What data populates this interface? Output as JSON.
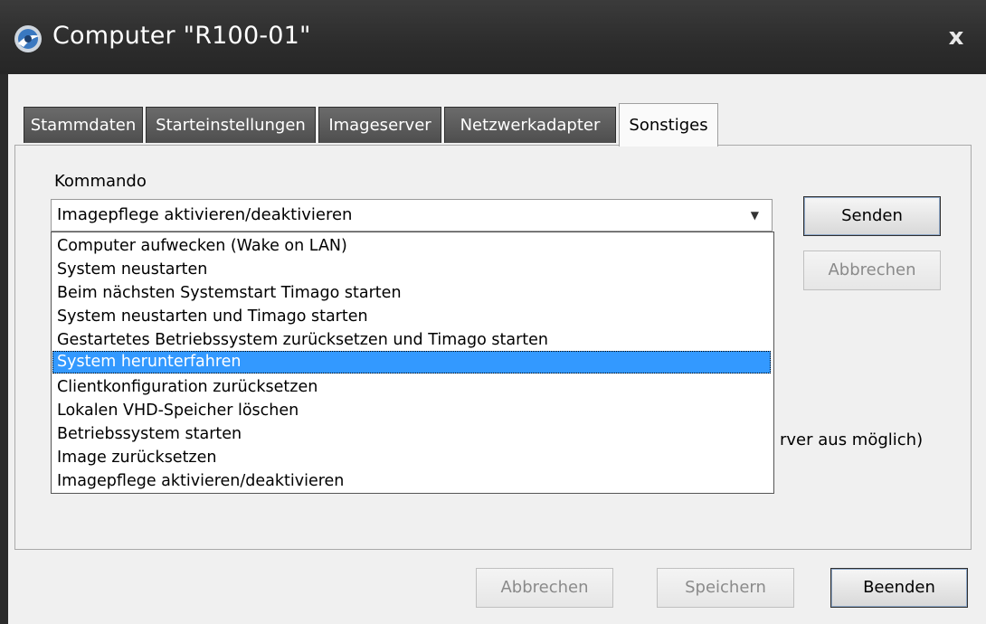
{
  "window": {
    "title": "Computer \"R100-01\"",
    "close_glyph": "x",
    "icon": "app-logo-icon"
  },
  "tabs": [
    {
      "label": "Stammdaten",
      "active": false
    },
    {
      "label": "Starteinstellungen",
      "active": false
    },
    {
      "label": "Imageserver",
      "active": false
    },
    {
      "label": "Netzwerkadapter",
      "active": false
    },
    {
      "label": "Sonstiges",
      "active": true
    }
  ],
  "kommando": {
    "label": "Kommando",
    "selected_value": "Imagepflege aktivieren/deaktivieren",
    "options": [
      "Computer aufwecken (Wake on LAN)",
      "System neustarten",
      "Beim nächsten Systemstart Timago starten",
      "System neustarten und Timago starten",
      "Gestartetes Betriebssystem zurücksetzen und Timago starten",
      "System herunterfahren",
      "Clientkonfiguration zurücksetzen",
      "Lokalen VHD-Speicher löschen",
      "Betriebssystem starten",
      "Image zurücksetzen",
      "Imagepflege aktivieren/deaktivieren"
    ],
    "highlighted_index": 5
  },
  "side_buttons": {
    "send": "Senden",
    "cancel": "Abbrechen"
  },
  "partial_text": "rver aus möglich)",
  "footer_buttons": {
    "cancel": "Abbrechen",
    "save": "Speichern",
    "close": "Beenden"
  },
  "colors": {
    "titlebar": "#2c2c2c",
    "selection": "#3399ff",
    "inactive_tab": "#5a5a5a"
  }
}
